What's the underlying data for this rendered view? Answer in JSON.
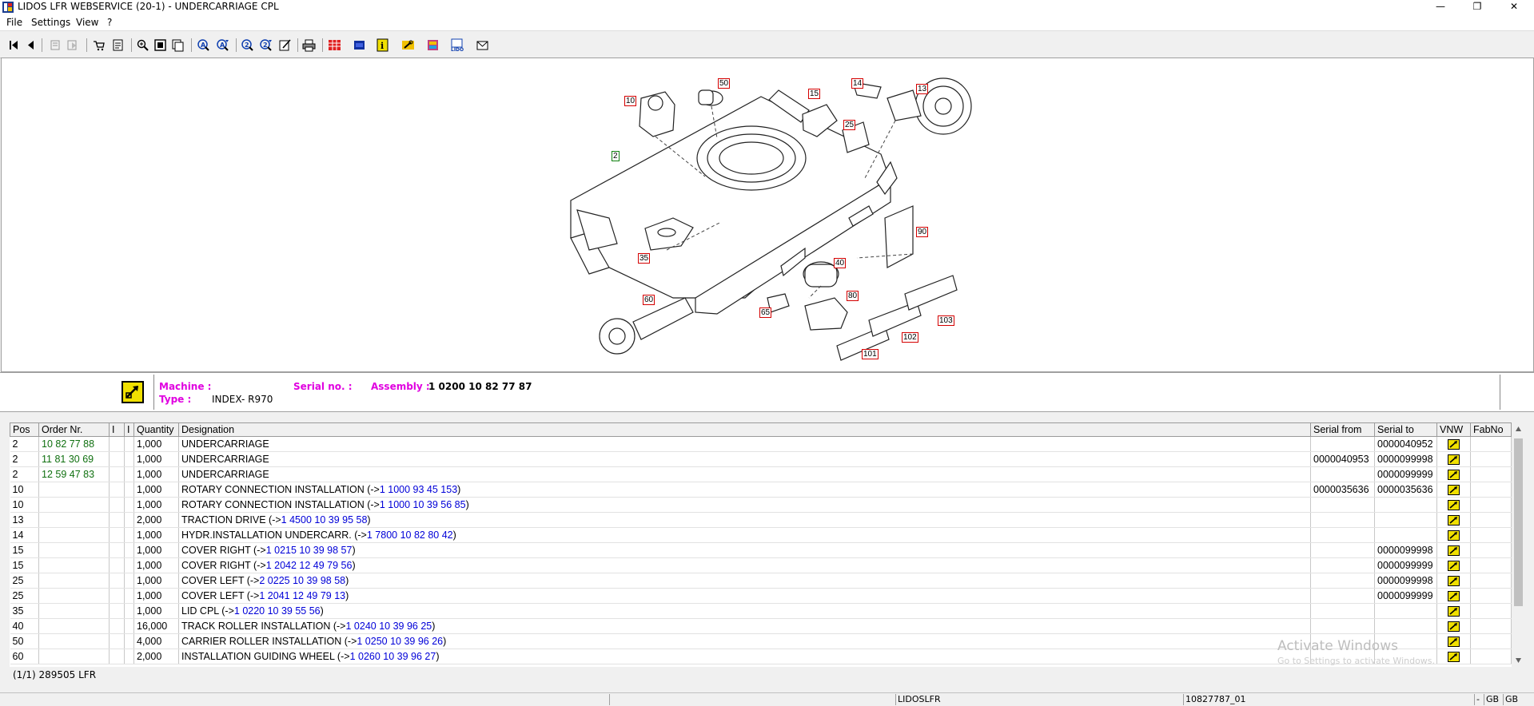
{
  "window": {
    "title": "LIDOS LFR WEBSERVICE (20-1) - UNDERCARRIAGE CPL",
    "minimize": "—",
    "restore": "❐",
    "close": "✕"
  },
  "menu": [
    "File",
    "Settings",
    "View",
    "?"
  ],
  "toolbar_icons": [
    "first-page-icon",
    "previous-page-icon",
    "back-disabled-icon",
    "forward-disabled-icon",
    "cart-icon",
    "order-list-icon",
    "zoom-in-icon",
    "page-icon",
    "page-copy-icon",
    "search-a-icon",
    "search-a-next-icon",
    "search-2-icon",
    "search-2-next-icon",
    "edit-icon",
    "print-icon",
    "grid-icon",
    "layers-icon",
    "info-icon",
    "tools-icon",
    "book-icon",
    "lidos-icon",
    "mail-icon"
  ],
  "drawing": {
    "callouts": [
      {
        "label": "50",
        "color": "red"
      },
      {
        "label": "10",
        "color": "red"
      },
      {
        "label": "15",
        "color": "red"
      },
      {
        "label": "14",
        "color": "red"
      },
      {
        "label": "13",
        "color": "red"
      },
      {
        "label": "25",
        "color": "red"
      },
      {
        "label": "2",
        "color": "green"
      },
      {
        "label": "90",
        "color": "red"
      },
      {
        "label": "35",
        "color": "red"
      },
      {
        "label": "40",
        "color": "red"
      },
      {
        "label": "60",
        "color": "red"
      },
      {
        "label": "80",
        "color": "red"
      },
      {
        "label": "65",
        "color": "red"
      },
      {
        "label": "103",
        "color": "red"
      },
      {
        "label": "102",
        "color": "red"
      },
      {
        "label": "101",
        "color": "red"
      }
    ]
  },
  "info": {
    "machine_label": "Machine :",
    "machine_value": "",
    "serial_label": "Serial no. :",
    "serial_value": "",
    "assembly_label": "Assembly :",
    "assembly_value": "1 0200 10 82 77 87",
    "type_label": "Type :",
    "type_value": "INDEX- R970"
  },
  "table": {
    "columns": [
      "Pos",
      "Order Nr.",
      "I",
      "I",
      "Quantity",
      "Designation",
      "Serial from",
      "Serial to",
      "VNW",
      "FabNo"
    ],
    "rows": [
      {
        "pos": "2",
        "order": "10 82 77 88",
        "qty": "1,000",
        "designation": "UNDERCARRIAGE",
        "ref": "",
        "serial_from": "",
        "serial_to": "0000040952"
      },
      {
        "pos": "2",
        "order": "11 81 30 69",
        "qty": "1,000",
        "designation": "UNDERCARRIAGE",
        "ref": "",
        "serial_from": "0000040953",
        "serial_to": "0000099998"
      },
      {
        "pos": "2",
        "order": "12 59 47 83",
        "qty": "1,000",
        "designation": "UNDERCARRIAGE",
        "ref": "",
        "serial_from": "",
        "serial_to": "0000099999"
      },
      {
        "pos": "10",
        "order": "",
        "qty": "1,000",
        "designation": "ROTARY CONNECTION INSTALLATION (->",
        "ref": "1 1000 93 45 153",
        "serial_from": "0000035636",
        "serial_to": "0000035636"
      },
      {
        "pos": "10",
        "order": "",
        "qty": "1,000",
        "designation": "ROTARY CONNECTION INSTALLATION (->",
        "ref": "1 1000 10 39 56 85",
        "serial_from": "",
        "serial_to": ""
      },
      {
        "pos": "13",
        "order": "",
        "qty": "2,000",
        "designation": "TRACTION DRIVE (->",
        "ref": "1 4500 10 39 95 58",
        "serial_from": "",
        "serial_to": ""
      },
      {
        "pos": "14",
        "order": "",
        "qty": "1,000",
        "designation": "HYDR.INSTALLATION UNDERCARR. (->",
        "ref": "1 7800 10 82 80 42",
        "serial_from": "",
        "serial_to": ""
      },
      {
        "pos": "15",
        "order": "",
        "qty": "1,000",
        "designation": "COVER RIGHT (->",
        "ref": "1 0215 10 39 98 57",
        "serial_from": "",
        "serial_to": "0000099998"
      },
      {
        "pos": "15",
        "order": "",
        "qty": "1,000",
        "designation": "COVER RIGHT (->",
        "ref": "1 2042 12 49 79 56",
        "serial_from": "",
        "serial_to": "0000099999"
      },
      {
        "pos": "25",
        "order": "",
        "qty": "1,000",
        "designation": "COVER LEFT (->",
        "ref": "2 0225 10 39 98 58",
        "serial_from": "",
        "serial_to": "0000099998"
      },
      {
        "pos": "25",
        "order": "",
        "qty": "1,000",
        "designation": "COVER LEFT (->",
        "ref": "1 2041 12 49 79 13",
        "serial_from": "",
        "serial_to": "0000099999"
      },
      {
        "pos": "35",
        "order": "",
        "qty": "1,000",
        "designation": "LID CPL (->",
        "ref": "1 0220 10 39 55 56",
        "serial_from": "",
        "serial_to": ""
      },
      {
        "pos": "40",
        "order": "",
        "qty": "16,000",
        "designation": "TRACK ROLLER INSTALLATION (->",
        "ref": "1 0240 10 39 96 25",
        "serial_from": "",
        "serial_to": ""
      },
      {
        "pos": "50",
        "order": "",
        "qty": "4,000",
        "designation": "CARRIER ROLLER INSTALLATION (->",
        "ref": "1 0250 10 39 96 26",
        "serial_from": "",
        "serial_to": ""
      },
      {
        "pos": "60",
        "order": "",
        "qty": "2,000",
        "designation": "INSTALLATION GUIDING WHEEL (->",
        "ref": "1 0260 10 39 96 27",
        "serial_from": "",
        "serial_to": ""
      }
    ]
  },
  "footer": "(1/1) 289505 LFR",
  "status": {
    "pane1": "LIDOSLFR",
    "pane2": "10827787_01",
    "pane3": "-",
    "pane4": "GB",
    "pane5": "GB"
  },
  "watermark": {
    "line1": "Activate Windows",
    "line2": "Go to Settings to activate Windows."
  }
}
